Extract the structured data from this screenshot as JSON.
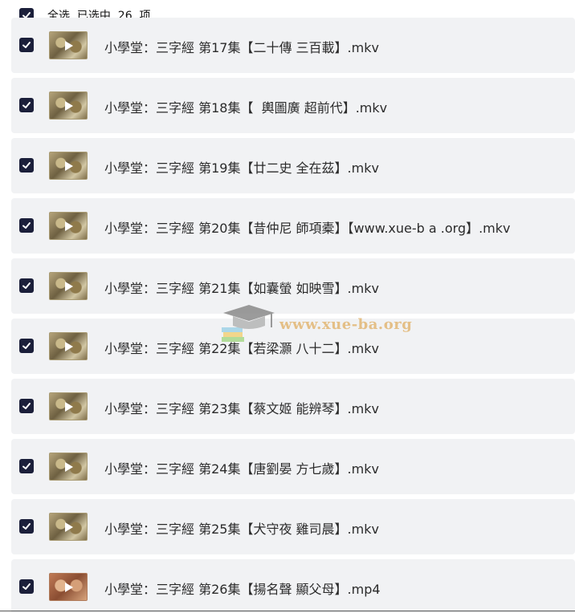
{
  "select_all": {
    "checked": true,
    "label": "全选  已选中  26  项"
  },
  "files": [
    {
      "name": "小學堂：三字經 第17集【二十傳 三百載】.mkv",
      "checked": true,
      "thumb": "video-thumbnail"
    },
    {
      "name": "小學堂：三字經 第18集【  輿圖廣 超前代】.mkv",
      "checked": true,
      "thumb": "video-thumbnail"
    },
    {
      "name": "小學堂：三字經 第19集【廿二史 全在茲】.mkv",
      "checked": true,
      "thumb": "video-thumbnail"
    },
    {
      "name": "小學堂：三字經 第20集【昔仲尼 師項橐】【www.xue-b a .org】.mkv",
      "checked": true,
      "thumb": "video-thumbnail"
    },
    {
      "name": "小學堂：三字經 第21集【如囊螢 如映雪】.mkv",
      "checked": true,
      "thumb": "video-thumbnail"
    },
    {
      "name": "小學堂：三字經 第22集【若梁灝 八十二】.mkv",
      "checked": true,
      "thumb": "video-thumbnail"
    },
    {
      "name": "小學堂：三字經 第23集【蔡文姬 能辨琴】.mkv",
      "checked": true,
      "thumb": "video-thumbnail"
    },
    {
      "name": "小學堂：三字經 第24集【唐劉晏 方七歲】.mkv",
      "checked": true,
      "thumb": "video-thumbnail"
    },
    {
      "name": "小學堂：三字經 第25集【犬守夜 雞司晨】.mkv",
      "checked": true,
      "thumb": "video-thumbnail"
    },
    {
      "name": "小學堂：三字經 第26集【揚名聲 顯父母】.mp4",
      "checked": true,
      "thumb": "video-thumbnail-alt"
    }
  ],
  "watermark": {
    "text": "www.xue-ba.org"
  },
  "colors": {
    "checkbox": "#1b1f3a",
    "row_background": "#f1f2f4",
    "watermark": "#e2b774"
  }
}
